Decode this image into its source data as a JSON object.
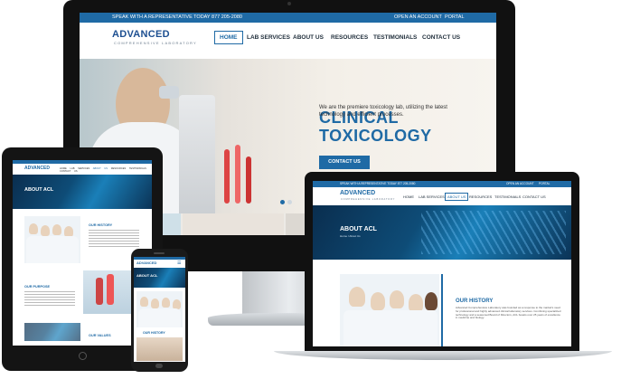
{
  "imac": {
    "topbar_left": "SPEAK WITH A REPRESENTATIVE TODAY 877 205-2080",
    "topbar_right": [
      "OPEN AN ACCOUNT",
      "PORTAL"
    ],
    "logo": "ADVANCED",
    "logo_sub": "COMPREHENSIVE LABORATORY",
    "nav": [
      "HOME",
      "LAB SERVICES",
      "ABOUT US",
      "RESOURCES",
      "TESTIMONIALS",
      "CONTACT US"
    ],
    "hero_title_line1": "CLINICAL",
    "hero_title_line2": "TOXICOLOGY",
    "hero_text": "We are the premiere toxicology lab, utilizing the latest technology and efficient processes.",
    "hero_button": "CONTACT US"
  },
  "tablet": {
    "logo": "ADVANCED",
    "nav": [
      "HOME",
      "LAB SERVICES",
      "ABOUT US",
      "RESOURCES",
      "TESTIMONIALS",
      "CONTACT US"
    ],
    "banner_title": "ABOUT ACL",
    "section1": "OUR HISTORY",
    "section2": "OUR PURPOSE",
    "section3": "OUR VALUES"
  },
  "laptop": {
    "topbar_left": "SPEAK WITH A REPRESENTATIVE TODAY 877 205-2080",
    "topbar_right": [
      "OPEN AN ACCOUNT",
      "PORTAL"
    ],
    "logo": "ADVANCED",
    "logo_sub": "COMPREHENSIVE LABORATORY",
    "nav": [
      "HOME",
      "LAB SERVICES",
      "ABOUT US",
      "RESOURCES",
      "TESTIMONIALS",
      "CONTACT US"
    ],
    "banner_title": "ABOUT ACL",
    "breadcrumb": "Home / About Us",
    "section_title": "OUR HISTORY",
    "section_text": "Advanced Comprehensive Laboratory was founded as a response to the market's need for professional and highly advanced clinical laboratory services. Combining specialized technology and a seasoned Board of Directors, ACL boasts over 25 years of excellence in medicine and biology."
  },
  "phone": {
    "logo": "ADVANCED",
    "banner_title": "ABOUT ACL",
    "section_title": "OUR HISTORY"
  },
  "colors": {
    "brand": "#1f6aa5",
    "dark": "#111111"
  }
}
